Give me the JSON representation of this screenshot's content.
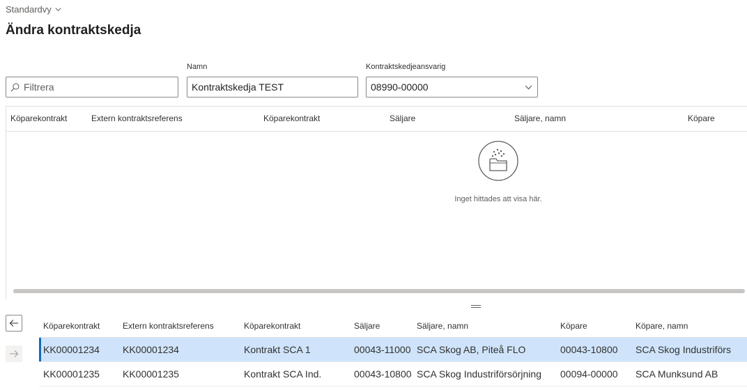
{
  "header": {
    "view_name": "Standardvy",
    "page_title": "Ändra kontraktskedja"
  },
  "filters": {
    "filter_placeholder": "Filtrera",
    "name_label": "Namn",
    "name_value": "Kontraktskedja TEST",
    "responsible_label": "Kontraktskedjeansvarig",
    "responsible_value": "08990-00000"
  },
  "upper_grid": {
    "columns": [
      "Köparekontrakt",
      "Extern kontraktsreferens",
      "Köparekontrakt",
      "Säljare",
      "Säljare, namn",
      "Köpare"
    ],
    "empty_message": "Inget hittades att visa här."
  },
  "lower_grid": {
    "columns": [
      "Köparekontrakt",
      "Extern kontraktsreferens",
      "Köparekontrakt",
      "Säljare",
      "Säljare, namn",
      "Köpare",
      "Köpare, namn"
    ],
    "rows": [
      [
        "KK00001234",
        "KK00001234",
        "Kontrakt SCA 1",
        "00043-11000",
        "SCA Skog AB, Piteå FLO",
        "00043-10800",
        "SCA Skog Industriförs"
      ],
      [
        "KK00001235",
        "KK00001235",
        "Kontrakt SCA Ind.",
        "00043-10800",
        "SCA Skog Industriförsörjning",
        "00094-00000",
        "SCA Munksund AB"
      ]
    ],
    "selected_row": 0
  },
  "colors": {
    "accent": "#0f6cbd",
    "selected_row_bg": "#cfe4fa"
  },
  "icons": [
    "chevron-down-icon",
    "search-icon",
    "empty-folder-icon",
    "arrow-left-icon",
    "arrow-right-icon"
  ]
}
